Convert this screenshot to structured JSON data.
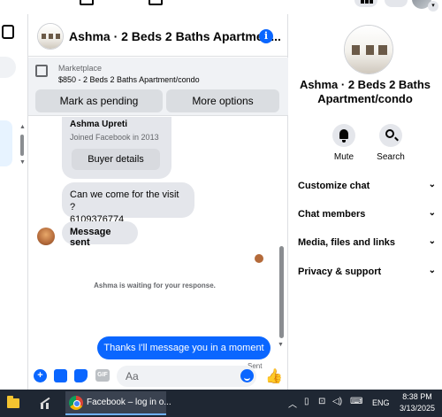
{
  "chat": {
    "title": "Ashma · 2 Beds 2 Baths Apartmen...",
    "marketplace": {
      "label": "Marketplace",
      "item": "$850 - 2 Beds 2 Baths Apartment/condo",
      "mark_pending_label": "Mark as pending",
      "more_options_label": "More options"
    },
    "buyer": {
      "name": "Ashma Upreti",
      "joined": "Joined Facebook in 2013",
      "details_button": "Buyer details"
    },
    "messages": {
      "visit_line1": "Can we come for the visit ?",
      "visit_line2": "6109376774",
      "message_sent": "Message sent",
      "waiting_notice": "Ashma is waiting for your response.",
      "my_reply": "Thanks I'll message you in a moment",
      "sent_status": "Sent"
    },
    "composer": {
      "placeholder": "Aa",
      "gif_label": "GIF"
    }
  },
  "info_panel": {
    "title": "Ashma · 2 Beds 2 Baths Apartment/condo",
    "actions": {
      "mute_label": "Mute",
      "search_label": "Search"
    },
    "sections": {
      "customize_chat": "Customize chat",
      "chat_members": "Chat members",
      "media_files_links": "Media, files and links",
      "privacy_support": "Privacy & support"
    }
  },
  "taskbar": {
    "active_window": "Facebook – log in o...",
    "language": "ENG",
    "time": "8:38 PM",
    "date": "3/13/2025"
  },
  "colors": {
    "accent": "#0a66ff",
    "bubble_gray": "#e4e6eb",
    "banner_bg": "#f0f2f5",
    "taskbar_bg": "#1f2733"
  },
  "icons": [
    "compose-icon",
    "info-icon",
    "marketplace-icon",
    "bell-icon",
    "search-icon",
    "chevron-down-icon",
    "plus-icon",
    "photo-icon",
    "sticker-icon",
    "gif-icon",
    "emoji-icon",
    "thumbs-up-icon",
    "folder-icon",
    "chrome-icon"
  ]
}
